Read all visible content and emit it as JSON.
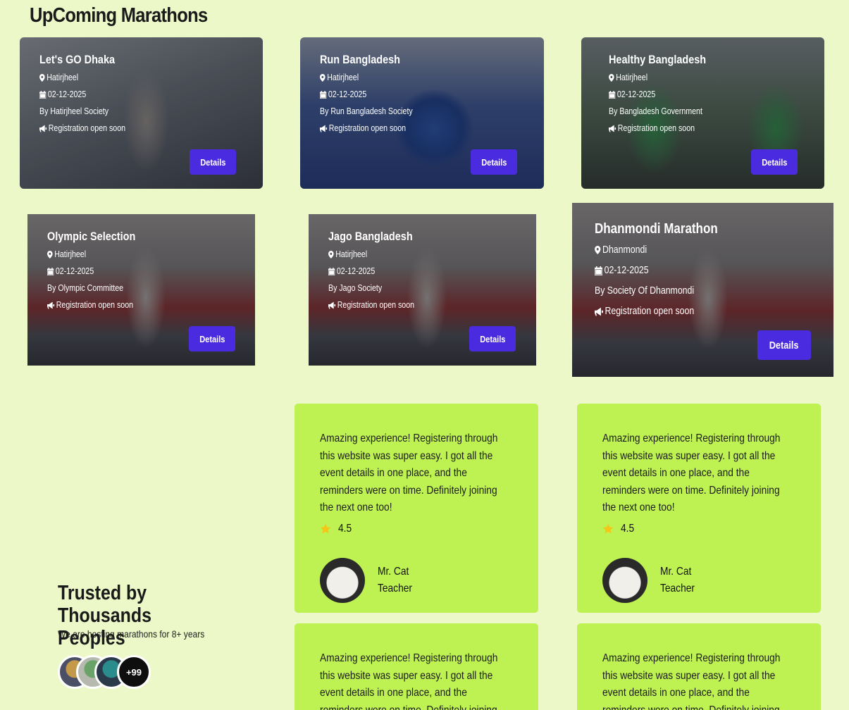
{
  "section_title": "UpComing Marathons",
  "marathons": [
    {
      "title": "Let's GO Dhaka",
      "location": "Hatirjheel",
      "date": "02-12-2025",
      "organizer": "By Hatirjheel Society",
      "status": "Registration open soon",
      "button": "Details",
      "image": "dhaka-runner-flag"
    },
    {
      "title": "Run Bangladesh",
      "location": "Hatirjheel",
      "date": "02-12-2025",
      "organizer": "By Run Bangladesh Society",
      "status": "Registration open soon",
      "button": "Details",
      "image": "run-bangladesh-stage"
    },
    {
      "title": "Healthy Bangladesh",
      "location": "Hatirjheel",
      "date": "02-12-2025",
      "organizer": "By Bangladesh Government",
      "status": "Registration open soon",
      "button": "Details",
      "image": "green-runners"
    },
    {
      "title": "Olympic Selection",
      "location": "Hatirjheel",
      "date": "02-12-2025",
      "organizer": "By Olympic Committee",
      "status": "Registration open soon",
      "button": "Details",
      "image": "finish-line-runner"
    },
    {
      "title": "Jago Bangladesh",
      "location": "Hatirjheel",
      "date": "02-12-2025",
      "organizer": "By Jago Society",
      "status": "Registration open soon",
      "button": "Details",
      "image": "finish-line-runner"
    },
    {
      "title": "Dhanmondi Marathon",
      "location": "Dhanmondi",
      "date": "02-12-2025",
      "organizer": "By Society Of Dhanmondi",
      "status": "Registration open soon",
      "button": "Details",
      "image": "finish-line-runner"
    }
  ],
  "trust": {
    "title": "Trusted by Thousands Peoples",
    "subtitle": "We are hosting marathons for 8+ years",
    "more_count": "+99"
  },
  "reviews": [
    {
      "text": "Amazing experience! Registering through this website was super easy. I got all the event details in one place, and the reminders were on time. Definitely joining the next one too!",
      "rating": "4.5",
      "name": "Mr. Cat",
      "role": "Teacher"
    },
    {
      "text": "Amazing experience! Registering through this website was super easy. I got all the event details in one place, and the reminders were on time. Definitely joining the next one too!",
      "rating": "4.5",
      "name": "Mr. Cat",
      "role": "Teacher"
    },
    {
      "text": "Amazing experience! Registering through this website was super easy. I got all the event details in one place, and the reminders were on time. Definitely joining the next one too!",
      "rating": "",
      "name": "",
      "role": ""
    },
    {
      "text": "Amazing experience! Registering through this website was super easy. I got all the event details in one place, and the reminders were on time. Definitely joining the next one too!",
      "rating": "",
      "name": "",
      "role": ""
    }
  ],
  "colors": {
    "page_bg": "#ecf8c8",
    "review_card": "#bef252",
    "button": "#4a2be0",
    "star": "#f5c518"
  }
}
